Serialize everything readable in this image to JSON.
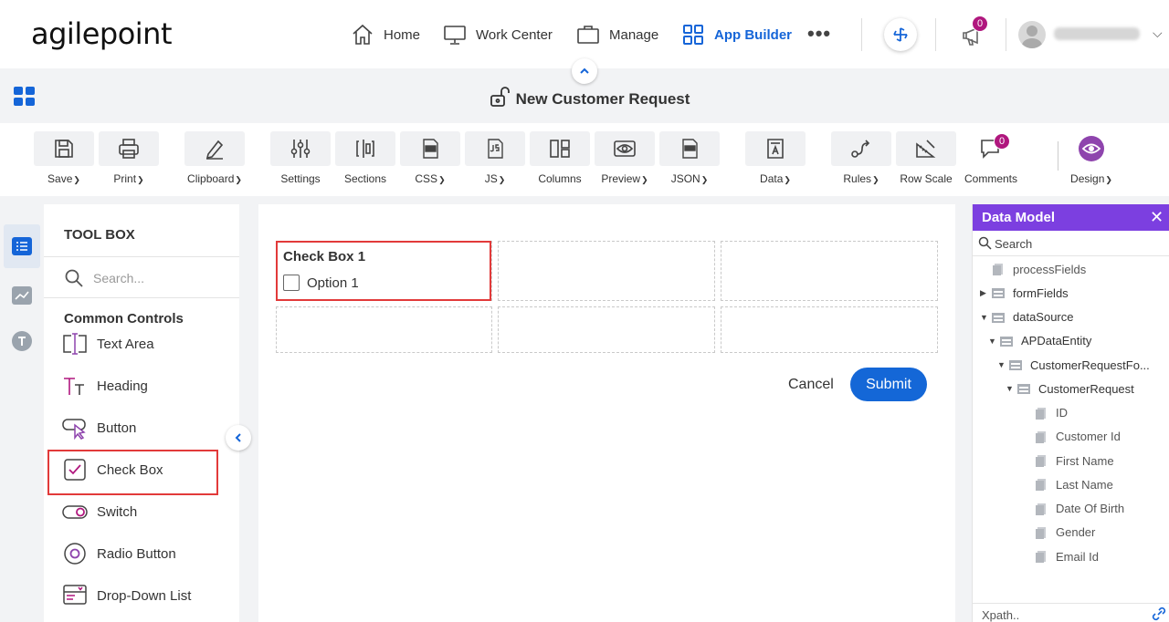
{
  "header": {
    "logo": "agilepoint",
    "nav": [
      {
        "label": "Home",
        "icon": "home-icon"
      },
      {
        "label": "Work Center",
        "icon": "monitor-icon"
      },
      {
        "label": "Manage",
        "icon": "briefcase-icon"
      },
      {
        "label": "App Builder",
        "icon": "grid-icon",
        "active": true
      }
    ],
    "more": "•••",
    "notification_count": "0",
    "accent_color": "#1565d8"
  },
  "title_bar": {
    "title": "New Customer Request"
  },
  "ribbon": {
    "items": [
      {
        "label": "Save",
        "icon": "save-icon",
        "dropdown": true
      },
      {
        "label": "Print",
        "icon": "print-icon",
        "dropdown": true
      },
      {
        "label": "Clipboard",
        "icon": "clipboard-icon",
        "dropdown": true
      },
      {
        "label": "Settings",
        "icon": "settings-sliders-icon",
        "dropdown": false
      },
      {
        "label": "Sections",
        "icon": "sections-icon",
        "dropdown": false
      },
      {
        "label": "CSS",
        "icon": "css-file-icon",
        "dropdown": true
      },
      {
        "label": "JS",
        "icon": "js-file-icon",
        "dropdown": true
      },
      {
        "label": "Columns",
        "icon": "columns-icon",
        "dropdown": false
      },
      {
        "label": "Preview",
        "icon": "eye-icon",
        "dropdown": true
      },
      {
        "label": "JSON",
        "icon": "json-file-icon",
        "dropdown": true
      },
      {
        "label": "Data",
        "icon": "data-icon",
        "dropdown": true
      },
      {
        "label": "Rules",
        "icon": "rules-icon",
        "dropdown": true
      },
      {
        "label": "Row Scale",
        "icon": "row-scale-icon",
        "dropdown": false
      },
      {
        "label": "Comments",
        "icon": "comments-icon",
        "dropdown": false
      },
      {
        "label": "Design",
        "icon": "design-eye-icon",
        "dropdown": true
      }
    ],
    "comments_count": "0",
    "design_color": "#8e44ad"
  },
  "toolbox": {
    "title": "TOOL BOX",
    "search_placeholder": "Search...",
    "section": "Common Controls",
    "tools": [
      {
        "label": "Text Area",
        "icon": "text-area-icon"
      },
      {
        "label": "Heading",
        "icon": "heading-icon"
      },
      {
        "label": "Button",
        "icon": "button-icon"
      },
      {
        "label": "Check Box",
        "icon": "check-box-icon",
        "highlighted": true
      },
      {
        "label": "Switch",
        "icon": "switch-icon"
      },
      {
        "label": "Radio Button",
        "icon": "radio-button-icon"
      },
      {
        "label": "Drop-Down List",
        "icon": "drop-down-list-icon"
      }
    ]
  },
  "canvas": {
    "field_label": "Check Box 1",
    "option_label": "Option 1",
    "cancel_label": "Cancel",
    "submit_label": "Submit",
    "highlight_color": "#e23a3a"
  },
  "data_model": {
    "title": "Data Model",
    "search_placeholder": "Search",
    "xpath_placeholder": "Xpath..",
    "header_color": "#7c3fe0",
    "tree": [
      {
        "label": "processFields",
        "level": 0,
        "arrow": "",
        "kind": "leaf"
      },
      {
        "label": "formFields",
        "level": 0,
        "arrow": "▶",
        "kind": "group"
      },
      {
        "label": "dataSource",
        "level": 0,
        "arrow": "▼",
        "kind": "group"
      },
      {
        "label": "APDataEntity",
        "level": 1,
        "arrow": "▼",
        "kind": "group"
      },
      {
        "label": "CustomerRequestFo...",
        "level": 2,
        "arrow": "▼",
        "kind": "group"
      },
      {
        "label": "CustomerRequest",
        "level": 3,
        "arrow": "▼",
        "kind": "group"
      },
      {
        "label": "ID",
        "level": 4,
        "arrow": "",
        "kind": "leaf"
      },
      {
        "label": "Customer Id",
        "level": 4,
        "arrow": "",
        "kind": "leaf"
      },
      {
        "label": "First Name",
        "level": 4,
        "arrow": "",
        "kind": "leaf"
      },
      {
        "label": "Last Name",
        "level": 4,
        "arrow": "",
        "kind": "leaf"
      },
      {
        "label": "Date Of Birth",
        "level": 4,
        "arrow": "",
        "kind": "leaf"
      },
      {
        "label": "Gender",
        "level": 4,
        "arrow": "",
        "kind": "leaf"
      },
      {
        "label": "Email Id",
        "level": 4,
        "arrow": "",
        "kind": "leaf"
      }
    ]
  }
}
